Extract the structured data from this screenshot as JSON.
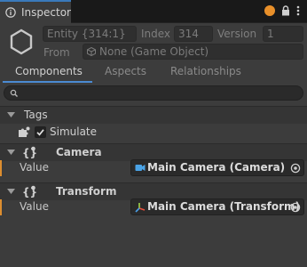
{
  "window": {
    "tab_title": "Inspector",
    "tab_icon": "info-icon",
    "controls": [
      "orange-dot",
      "lock-icon",
      "more-icon"
    ]
  },
  "entity": {
    "entity_label": "Entity {314:1}",
    "index_label": "Index",
    "index_value": "314",
    "version_label": "Version",
    "version_value": "1",
    "from_label": "From",
    "from_value": "None (Game Object)"
  },
  "subtabs": {
    "items": [
      "Components",
      "Aspects",
      "Relationships"
    ],
    "active": "Components"
  },
  "search": {
    "placeholder": ""
  },
  "tags": {
    "title": "Tags",
    "items": [
      {
        "name": "Simulate",
        "checked": true
      }
    ]
  },
  "components": [
    {
      "title": "Camera",
      "field_label": "Value",
      "field_value": "Main Camera (Camera)",
      "field_icon": "camera-icon"
    },
    {
      "title": "Transform",
      "field_label": "Value",
      "field_value": "Main Camera (Transform)",
      "field_icon": "transform-axes-icon"
    }
  ],
  "colors": {
    "accent": "#3a79bb",
    "orange": "#e9902a",
    "panel": "#3c3c3c",
    "tabbar": "#191919"
  }
}
